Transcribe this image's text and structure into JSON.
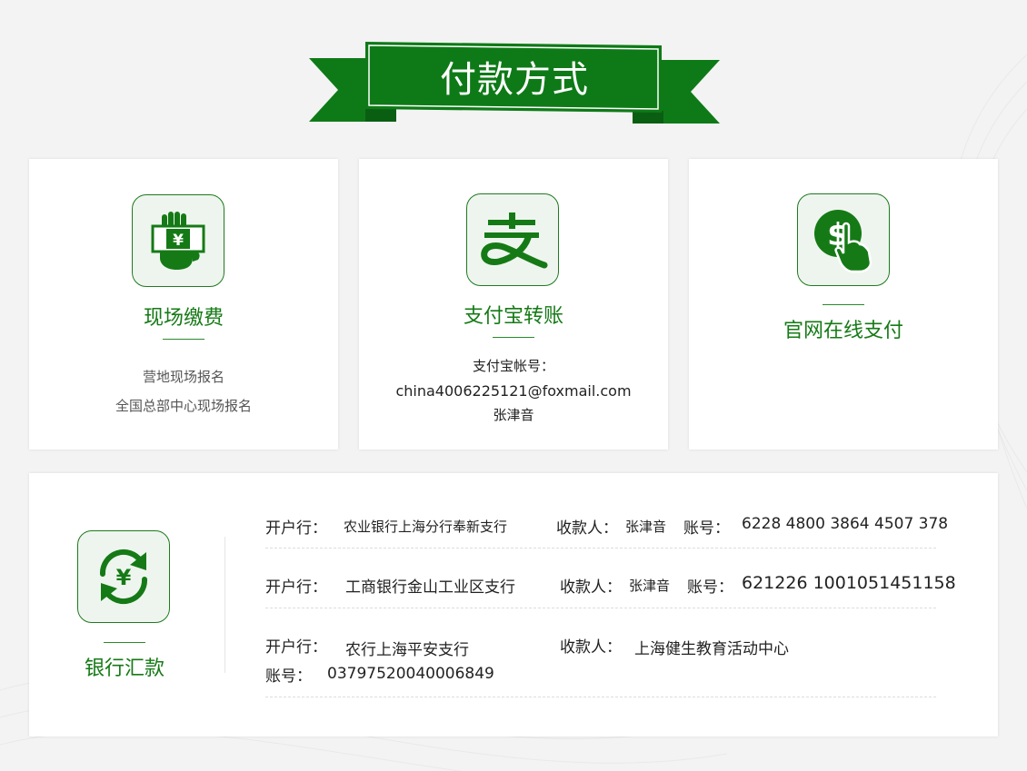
{
  "page_title": "付款方式",
  "colors": {
    "brand_green": "#0e7a17",
    "icon_bg": "#eef5ee",
    "divider": "#2a8a2a"
  },
  "cards": [
    {
      "title": "现场缴费",
      "icon": "cash-hand-icon",
      "lines": [
        "营地现场报名",
        "全国总部中心现场报名"
      ]
    },
    {
      "title": "支付宝转账",
      "icon": "alipay-icon",
      "lines": [
        "支付宝帐号：",
        "china4006225121@foxmail.com",
        "张津音"
      ]
    },
    {
      "title": "官网在线支付",
      "icon": "dollar-click-icon",
      "lines": []
    }
  ],
  "bank": {
    "title": "银行汇款",
    "icon": "yen-exchange-icon",
    "bank_label": "开户行：",
    "payee_label": "收款人：",
    "account_label": "账号：",
    "rows": [
      {
        "bank": "农业银行上海分行奉新支行",
        "payee": "张津音",
        "account": "6228 4800 3864 4507 378"
      },
      {
        "bank": "工商银行金山工业区支行",
        "payee": "张津音",
        "account": "621226 1001051451158"
      },
      {
        "bank": "农行上海平安支行",
        "payee": "上海健生教育活动中心",
        "account": "03797520040006849"
      }
    ]
  }
}
